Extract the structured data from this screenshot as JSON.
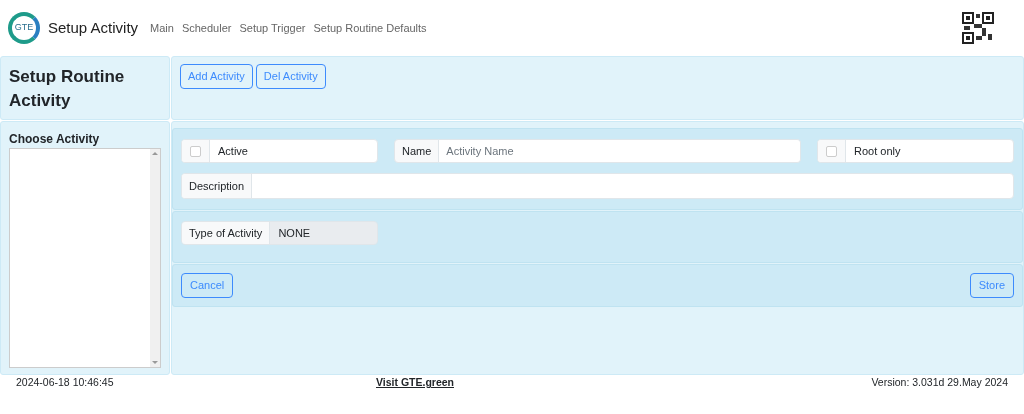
{
  "header": {
    "logo_text": "GTE",
    "title": "Setup Activity",
    "nav": [
      {
        "label": "Main"
      },
      {
        "label": "Scheduler"
      },
      {
        "label": "Setup Trigger"
      },
      {
        "label": "Setup Routine Defaults"
      }
    ]
  },
  "page_title": "Setup Routine Activity",
  "toolbar": [
    "Add Activity",
    "Del Activity"
  ],
  "sidebar": {
    "label": "Choose Activity"
  },
  "form": {
    "active": {
      "label": "Active",
      "checked": false
    },
    "name": {
      "label": "Name",
      "placeholder": "Activity Name"
    },
    "root_only": {
      "label": "Root only",
      "checked": false
    },
    "description": {
      "label": "Description"
    },
    "type": {
      "label": "Type of Activity",
      "value": "NONE"
    }
  },
  "actions": {
    "cancel": "Cancel",
    "store": "Store"
  },
  "footer": {
    "datetime": "2024-06-18 10:46:45",
    "link": "Visit GTE.green",
    "version": "Version: 3.031d 29.May 2024"
  }
}
